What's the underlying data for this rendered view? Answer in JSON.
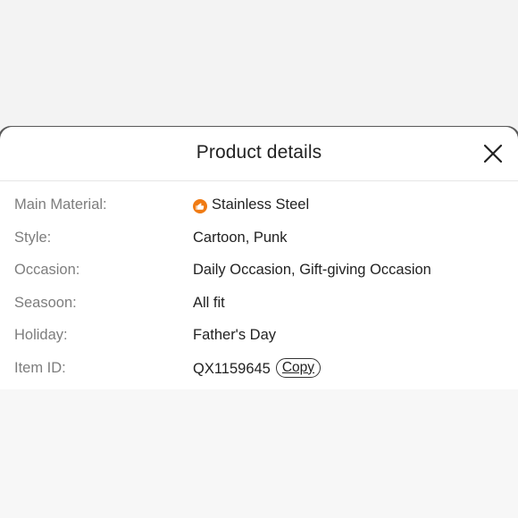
{
  "sheet": {
    "title": "Product details",
    "close_icon": "close-icon"
  },
  "details": [
    {
      "label": "Main Material:",
      "value": "Stainless Steel",
      "icon": "thumbs-up-badge-icon"
    },
    {
      "label": "Style:",
      "value": "Cartoon, Punk"
    },
    {
      "label": "Occasion:",
      "value": "Daily Occasion, Gift-giving Occasion"
    },
    {
      "label": "Seasoon:",
      "value": "All fit"
    },
    {
      "label": "Holiday:",
      "value": "Father's Day"
    },
    {
      "label": "Item ID:",
      "value": "QX1159645",
      "action": "Copy"
    }
  ],
  "colors": {
    "accent_badge": "#f07b14",
    "label_text": "#7d7d7d",
    "value_text": "#222222"
  }
}
